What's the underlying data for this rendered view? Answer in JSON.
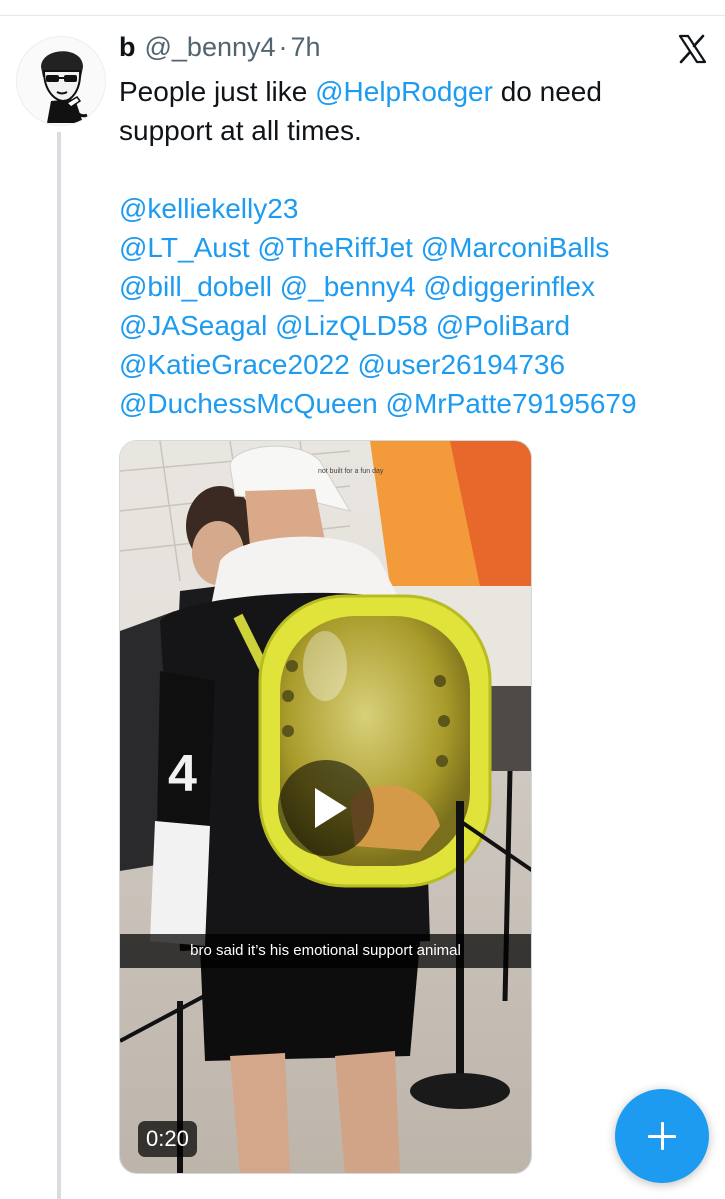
{
  "tweet": {
    "display_name": "b",
    "handle": "@_benny4",
    "separator": "·",
    "time": "7h",
    "text_lines": [
      [
        {
          "t": "People just like ",
          "m": false
        },
        {
          "t": "@HelpRodger",
          "m": true
        },
        {
          "t": " do need",
          "m": false
        }
      ],
      [
        {
          "t": "support at all times.",
          "m": false
        }
      ],
      [],
      [
        {
          "t": "@kelliekelly23",
          "m": true
        }
      ],
      [
        {
          "t": "@LT_Aust @TheRiffJet @MarconiBalls",
          "m": true
        }
      ],
      [
        {
          "t": "@bill_dobell @_benny4 @diggerinflex",
          "m": true
        }
      ],
      [
        {
          "t": "@JASeagal @LizQLD58 @PoliBard",
          "m": true
        }
      ],
      [
        {
          "t": "@KatieGrace2022 @user26194736",
          "m": true
        }
      ],
      [
        {
          "t": "@DuchessMcQueen @MrPatte79195679",
          "m": true
        }
      ]
    ]
  },
  "video": {
    "caption": "bro said it’s his emotional support animal",
    "duration": "0:20",
    "cap_text": "not built for a fun day",
    "jersey_number": "4"
  },
  "icons": {
    "x_logo": "x-logo-icon",
    "play": "play-icon",
    "compose": "plus-icon"
  },
  "colors": {
    "accent": "#1d9bf0",
    "text": "#0f1419",
    "muted": "#536471"
  }
}
